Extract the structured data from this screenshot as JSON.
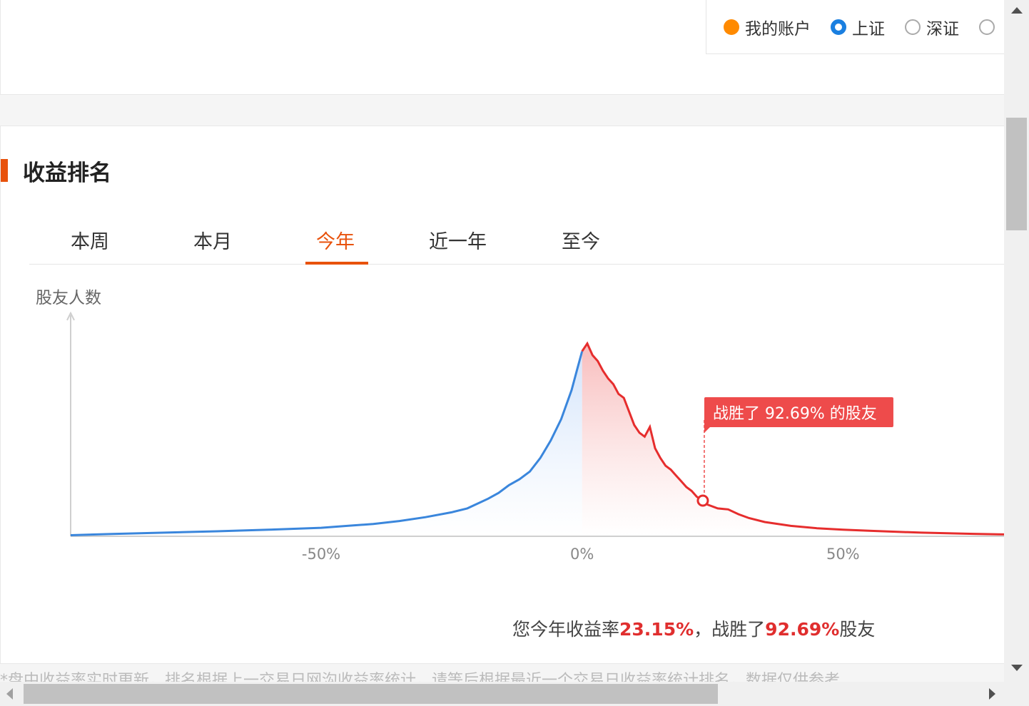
{
  "legend": {
    "items": [
      {
        "label": "我的账户",
        "kind": "swatch",
        "color": "#ff8a00"
      },
      {
        "label": "上证",
        "kind": "radio",
        "selected": true
      },
      {
        "label": "深证",
        "kind": "radio",
        "selected": false
      },
      {
        "label": "",
        "kind": "radio",
        "selected": false
      }
    ]
  },
  "section": {
    "title": "收益排名"
  },
  "tabs": [
    {
      "label": "本周",
      "active": false
    },
    {
      "label": "本月",
      "active": false
    },
    {
      "label": "今年",
      "active": true
    },
    {
      "label": "近一年",
      "active": false
    },
    {
      "label": "至今",
      "active": false
    }
  ],
  "chart_data": {
    "type": "area",
    "ylabel": "股友人数",
    "xlabel": "",
    "x_ticks": [
      {
        "value": -50,
        "label": "-50%"
      },
      {
        "value": 0,
        "label": "0%"
      },
      {
        "value": 50,
        "label": "50%"
      }
    ],
    "xlim": [
      -98,
      81
    ],
    "x": [
      -98,
      -90,
      -80,
      -70,
      -60,
      -50,
      -45,
      -40,
      -35,
      -30,
      -25,
      -22,
      -20,
      -18,
      -16,
      -14,
      -12,
      -10,
      -8,
      -6,
      -4,
      -2,
      -1,
      0,
      1,
      2,
      3,
      4,
      5,
      6,
      7,
      8,
      9,
      10,
      11,
      12,
      13,
      14,
      15,
      16,
      17,
      18,
      19,
      20,
      21,
      22,
      23.15,
      24,
      26,
      28,
      30,
      32,
      35,
      40,
      45,
      50,
      55,
      60,
      65,
      70,
      75,
      81
    ],
    "y": [
      0.2,
      0.8,
      1.5,
      2.2,
      3,
      4,
      5,
      6,
      7.5,
      9.5,
      12,
      14,
      16.5,
      19,
      22,
      26,
      29,
      33,
      40,
      49,
      60,
      75,
      85,
      95,
      99,
      93,
      90,
      85,
      81,
      78,
      73,
      71,
      64,
      57,
      53,
      51,
      56,
      45,
      40,
      36,
      34,
      31,
      28,
      25,
      23,
      20,
      18,
      16,
      14,
      13.5,
      11,
      9,
      7,
      5,
      3.8,
      3,
      2.5,
      2,
      1.5,
      1.2,
      0.9,
      0.6
    ],
    "series": [
      {
        "name": "",
        "segment": "negative",
        "color": "#3a86dc",
        "fill": "#dce9fb"
      },
      {
        "name": "",
        "segment": "positive",
        "color": "#e62d2d",
        "fill": "#f9c6c6"
      }
    ],
    "marker": {
      "x": 23.15,
      "label": "战胜了 92.69% 的股友",
      "color": "#ee4b4b"
    },
    "grid": false
  },
  "summary": {
    "prefix": "您今年收益率",
    "rate": "23.15%",
    "middle": "，战胜了",
    "beat": "92.69%",
    "suffix": "股友"
  },
  "footer_note": "*盘中收益率实时更新，排名根据上一交易日网沟收益率统计，请等后根据最近一个交易日收益率统计排名，数据仅供参考"
}
